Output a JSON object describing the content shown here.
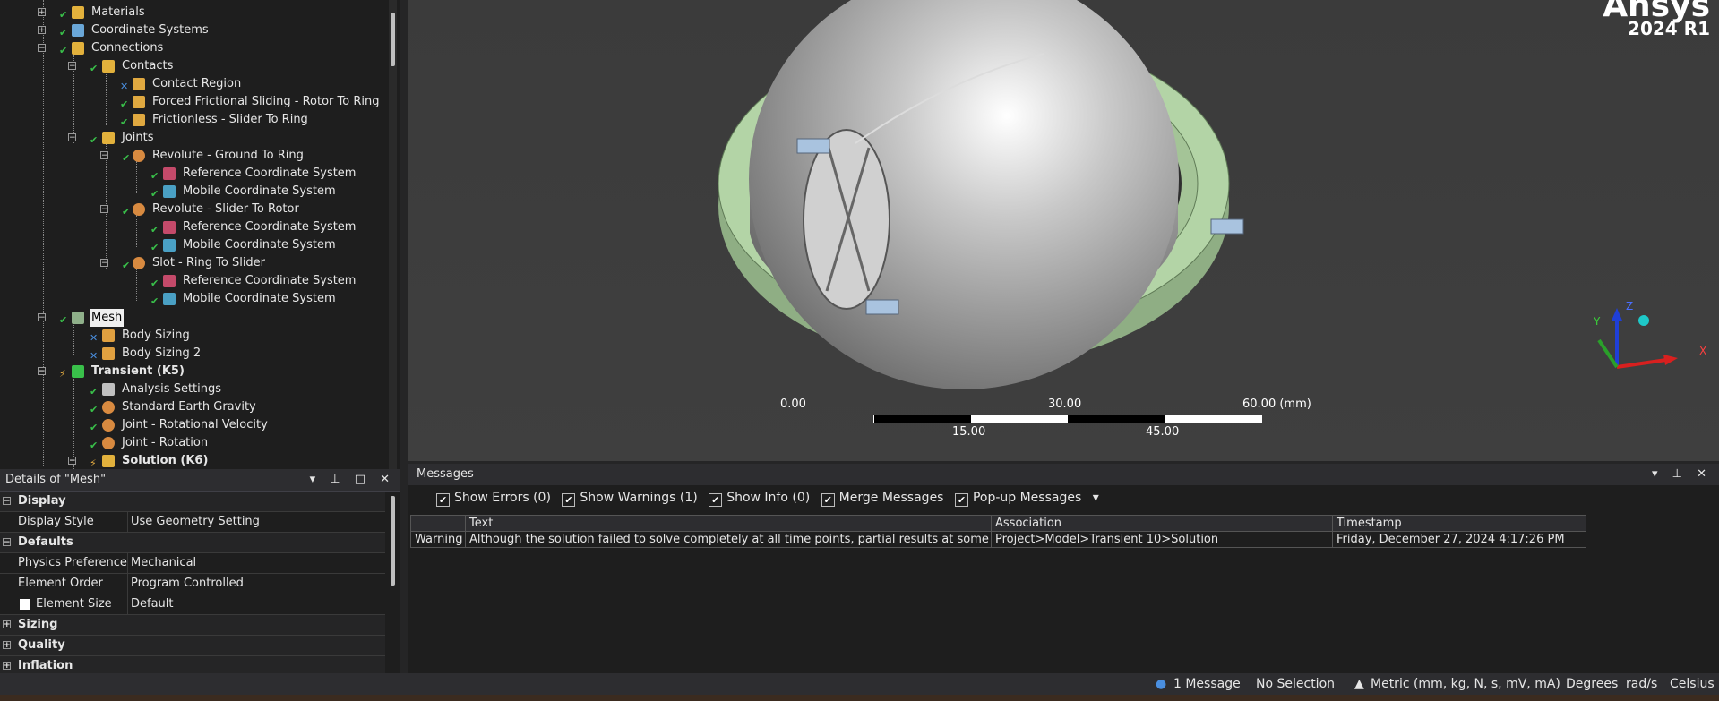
{
  "tree": {
    "items": [
      {
        "label": "Materials",
        "level": 1
      },
      {
        "label": "Coordinate Systems",
        "level": 1
      },
      {
        "label": "Connections",
        "level": 1
      },
      {
        "label": "Contacts",
        "level": 2
      },
      {
        "label": "Contact Region",
        "level": 3
      },
      {
        "label": "Forced Frictional Sliding - Rotor To Ring",
        "level": 3
      },
      {
        "label": "Frictionless - Slider To Ring",
        "level": 3
      },
      {
        "label": "Joints",
        "level": 2
      },
      {
        "label": "Revolute - Ground To Ring",
        "level": 3
      },
      {
        "label": "Reference Coordinate System",
        "level": 4
      },
      {
        "label": "Mobile Coordinate System",
        "level": 4
      },
      {
        "label": "Revolute - Slider To Rotor",
        "level": 3
      },
      {
        "label": "Reference Coordinate System",
        "level": 4
      },
      {
        "label": "Mobile Coordinate System",
        "level": 4
      },
      {
        "label": "Slot - Ring To Slider",
        "level": 3
      },
      {
        "label": "Reference Coordinate System",
        "level": 4
      },
      {
        "label": "Mobile Coordinate System",
        "level": 4
      },
      {
        "label": "Mesh",
        "level": 1
      },
      {
        "label": "Body Sizing",
        "level": 2
      },
      {
        "label": "Body Sizing 2",
        "level": 2
      },
      {
        "label": "Transient (K5)",
        "level": 1
      },
      {
        "label": "Analysis Settings",
        "level": 2
      },
      {
        "label": "Standard Earth Gravity",
        "level": 2
      },
      {
        "label": "Joint - Rotational Velocity",
        "level": 2
      },
      {
        "label": "Joint - Rotation",
        "level": 2
      },
      {
        "label": "Solution (K6)",
        "level": 2
      }
    ]
  },
  "details": {
    "title": "Details of \"Mesh\"",
    "controls": "▾ ⊥ □ ✕",
    "groups": {
      "display": "Display",
      "defaults": "Defaults",
      "sizing": "Sizing",
      "quality": "Quality",
      "inflation": "Inflation"
    },
    "rows": {
      "display_style": {
        "k": "Display Style",
        "v": "Use Geometry Setting"
      },
      "physics_pref": {
        "k": "Physics Preference",
        "v": "Mechanical"
      },
      "element_order": {
        "k": "Element Order",
        "v": "Program Controlled"
      },
      "element_size": {
        "k": "Element Size",
        "v": "Default"
      }
    }
  },
  "viewport": {
    "brand_name": "Ansys",
    "brand_version": "2024 R1",
    "scale": {
      "t0": "0.00",
      "t30": "30.00",
      "t60": "60.00 (mm)",
      "t15": "15.00",
      "t45": "45.00"
    },
    "axis": {
      "x": "X",
      "y": "Y",
      "z": "Z"
    }
  },
  "messages": {
    "title": "Messages",
    "controls": "▾ ⊥ ✕",
    "options": {
      "errors": "Show Errors  (0)",
      "warnings": "Show Warnings  (1)",
      "info": "Show Info  (0)",
      "merge": "Merge Messages",
      "popup": "Pop-up Messages"
    },
    "headers": {
      "type": "",
      "text": "Text",
      "assoc": "Association",
      "time": "Timestamp"
    },
    "row": {
      "type": "Warning",
      "text": "Although the solution failed to solve completely at all time points, partial results at some",
      "assoc": "Project>Model>Transient 10>Solution",
      "time": "Friday, December 27, 2024 4:17:26 PM"
    }
  },
  "status": {
    "messages": "1 Message",
    "selection": "No Selection",
    "units": "Metric (mm, kg, N, s, mV, mA)",
    "angle": "Degrees",
    "rate": "rad/s",
    "temp": "Celsius"
  },
  "colors": {
    "accent": "#39c04a",
    "ring": "#a7c99a",
    "dome": "#cfcfcf"
  }
}
